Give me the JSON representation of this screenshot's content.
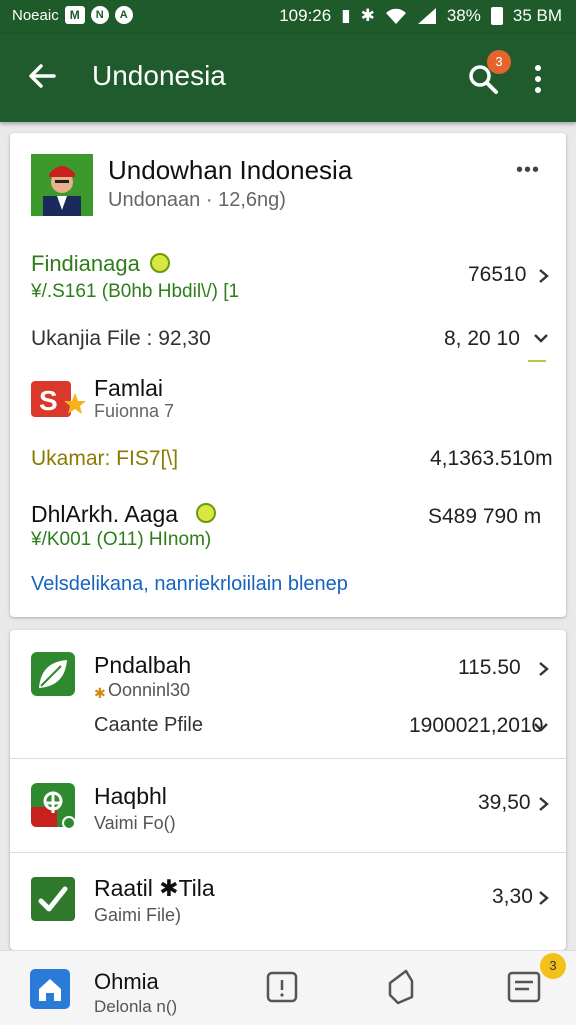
{
  "status_bar": {
    "carrier": "Noeaic",
    "icon1": "M",
    "icon2": "N",
    "icon3": "A",
    "time_left": "109:26",
    "battery": "38%",
    "time_right": "35 BM"
  },
  "app_bar": {
    "title": "Undonesia",
    "notification_count": "3"
  },
  "main_card": {
    "title": "Undowhan Indonesia",
    "subtitle": "Undonaan · 12,6ng)",
    "more_label": "•••",
    "item1": {
      "name": "Findianaga",
      "sub": "¥/.S161 (B0hb Hbdil\\/) [1",
      "value": "76510"
    },
    "file_row": {
      "label": "Ukanjia File : 92,30",
      "value": "8, 20 10"
    },
    "item2": {
      "name": "Famlai",
      "sub": "Fuionna 7"
    },
    "ukamar_row": {
      "label": "Ukamar: FIS7[\\]",
      "value": "4,1363.510m"
    },
    "item3": {
      "name": "DhlArkh. Aaga",
      "sub": "¥/K001 (O11) HInom)",
      "value": "S489 790 m"
    },
    "link": "Velsdelikana, nanriekrloiilain blenep"
  },
  "second_card": {
    "row1": {
      "name": "Pndalbah",
      "sub": "Oonninl30",
      "value": "115.50",
      "file_label": "Caante Pfile",
      "file_value": "1900021,2010"
    },
    "row2": {
      "name": "Haqbhl",
      "sub": "Vaimi Fo()",
      "value": "39,50"
    },
    "row3": {
      "name": "Raatil ✱Tila",
      "sub": "Gaimi File)",
      "value": "3,30"
    }
  },
  "bottom_nav": {
    "home_title": "Ohmia",
    "home_sub": "Delonla n()",
    "badge": "3"
  },
  "colors": {
    "app_bar": "#1f5b2c",
    "green_text": "#2e7d1a",
    "link": "#1565c0",
    "olive": "#8a7a00"
  },
  "icons": [
    "back-arrow-icon",
    "search-icon",
    "more-vert-icon",
    "avatar",
    "s-star-app-icon",
    "leaf-app-icon",
    "tree-app-icon",
    "check-app-icon",
    "home-icon",
    "info-icon",
    "tag-icon",
    "document-icon",
    "chevron-right-icon",
    "chevron-down-icon"
  ]
}
